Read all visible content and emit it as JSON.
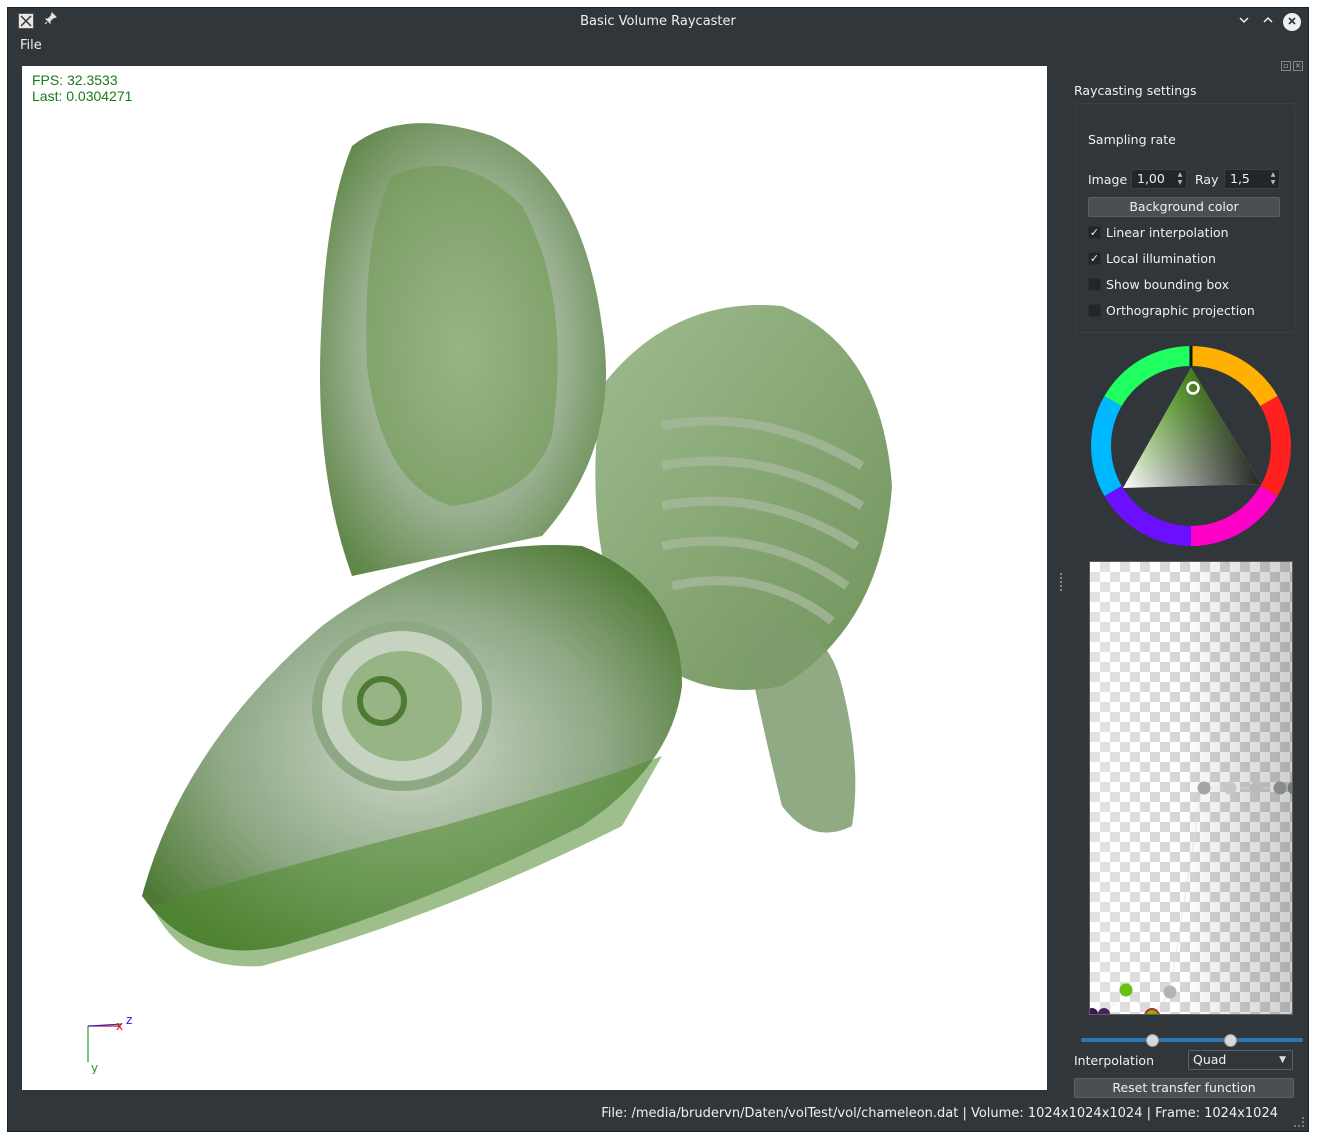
{
  "window": {
    "title": "Basic Volume Raycaster"
  },
  "menu": {
    "file": "File"
  },
  "viewport": {
    "fps_label": "FPS: 32.3533",
    "last_label": "Last: 0.0304271",
    "axes": {
      "x": "x",
      "y": "y",
      "z": "z"
    },
    "render_tint": "#4f8a2e"
  },
  "panel": {
    "section_title": "Raycasting settings",
    "sampling_rate_label": "Sampling rate",
    "image_label": "Image",
    "image_value": "1,00",
    "ray_label": "Ray",
    "ray_value": "1,5",
    "background_color_button": "Background color",
    "checks": [
      {
        "label": "Linear interpolation",
        "checked": true
      },
      {
        "label": "Local illumination",
        "checked": true
      },
      {
        "label": "Show bounding box",
        "checked": false
      },
      {
        "label": "Orthographic projection",
        "checked": false
      }
    ],
    "selected_color": "#4caf1e",
    "interpolation_label": "Interpolation",
    "interpolation_value": "Quad",
    "reset_button": "Reset transfer function"
  },
  "status": {
    "text": "File: /media/brudervn/Daten/volTest/vol/chameleon.dat | Volume: 1024x1024x1024 | Frame: 1024x1024"
  },
  "colors": {
    "window_bg": "#31363b",
    "accent": "#2a77b5",
    "fps_text": "#1a7a1a"
  }
}
